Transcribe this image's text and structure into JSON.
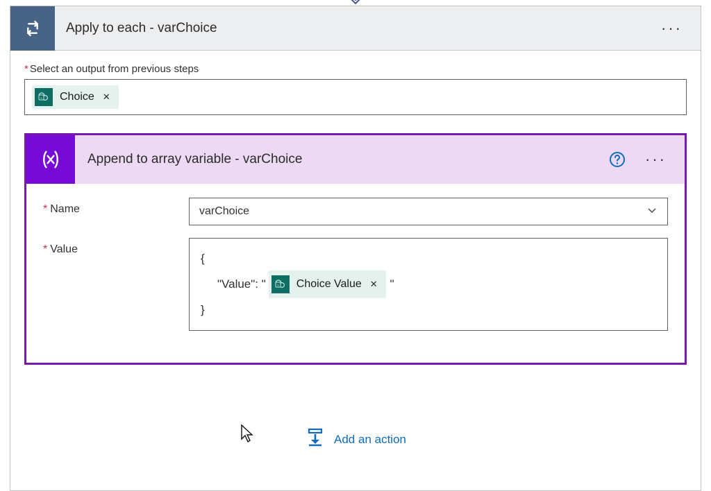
{
  "applyCard": {
    "title": "Apply to each - varChoice",
    "selectLabel": "Select an output from previous steps",
    "outputToken": "Choice"
  },
  "appendCard": {
    "title": "Append to array variable - varChoice",
    "nameLabel": "Name",
    "nameValue": "varChoice",
    "valueLabel": "Value",
    "valueLine1": "{",
    "valueLine2Prefix": "\"Value\": \"",
    "valueToken": "Choice Value",
    "valueLine2Suffix": "\"",
    "valueLine3": "}"
  },
  "addAction": "Add an action"
}
